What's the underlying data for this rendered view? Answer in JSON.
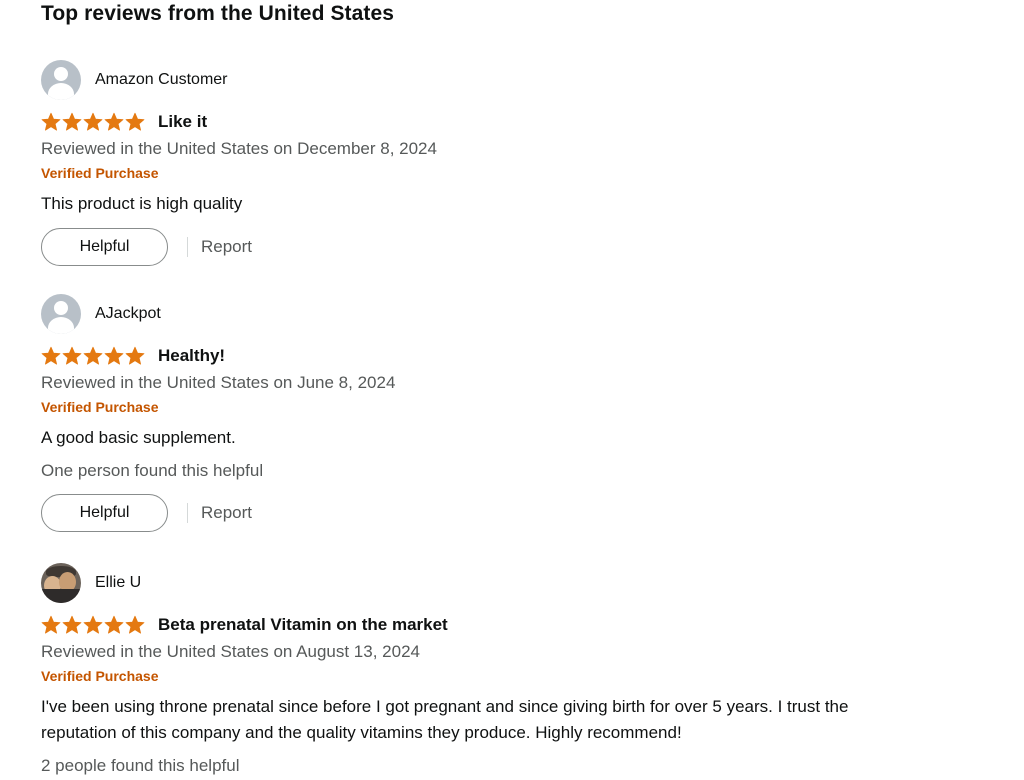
{
  "section": {
    "title": "Top reviews from the United States"
  },
  "colors": {
    "star": "#e47911",
    "verified": "#c45500",
    "muted_text": "#565959"
  },
  "reviews": [
    {
      "author": "Amazon Customer",
      "avatar": "default-avatar-icon",
      "rating": 5,
      "title": "Like it",
      "date_line": "Reviewed in the United States on December 8, 2024",
      "verified": "Verified Purchase",
      "body": "This product is high quality",
      "helpful_count": "",
      "helpful_label": "Helpful",
      "report_label": "Report"
    },
    {
      "author": "AJackpot",
      "avatar": "default-avatar-icon",
      "rating": 5,
      "title": "Healthy!",
      "date_line": "Reviewed in the United States on June 8, 2024",
      "verified": "Verified Purchase",
      "body": "A good basic supplement.",
      "helpful_count": "One person found this helpful",
      "helpful_label": "Helpful",
      "report_label": "Report"
    },
    {
      "author": "Ellie U",
      "avatar": "profile-photo",
      "rating": 5,
      "title": "Beta prenatal Vitamin on the market",
      "date_line": "Reviewed in the United States on August 13, 2024",
      "verified": "Verified Purchase",
      "body": "I've been using throne prenatal since before I got pregnant and since giving birth for over 5 years. I trust the reputation of this company and the quality vitamins they produce. Highly recommend!",
      "helpful_count": "2 people found this helpful"
    }
  ]
}
